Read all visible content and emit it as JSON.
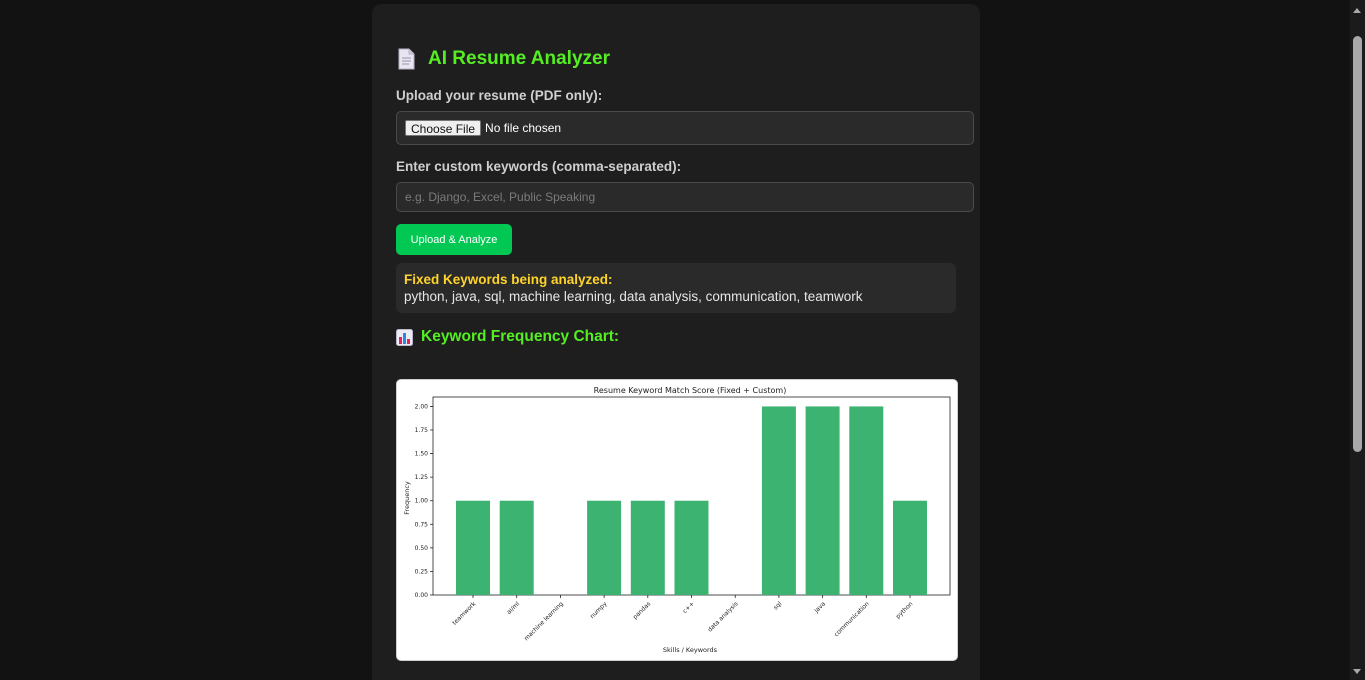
{
  "app": {
    "title": "AI Resume Analyzer",
    "title_icon": "document-icon",
    "accent_color": "#55ee22"
  },
  "upload": {
    "label": "Upload your resume (PDF only):",
    "button_label": "Choose File",
    "status": "No file chosen"
  },
  "keywords": {
    "label": "Enter custom keywords (comma-separated):",
    "value": "",
    "placeholder": "e.g. Django, Excel, Public Speaking"
  },
  "actions": {
    "analyze_label": "Upload & Analyze",
    "analyze_color": "#00c853"
  },
  "fixed_keywords": {
    "title": "Fixed Keywords being analyzed:",
    "list": "python, java, sql, machine learning, data analysis, communication, teamwork",
    "title_color": "#ffd42a"
  },
  "chart_section": {
    "heading": "Keyword Frequency Chart:",
    "heading_icon": "bar-chart-icon"
  },
  "chart_data": {
    "type": "bar",
    "title": "Resume Keyword Match Score (Fixed + Custom)",
    "xlabel": "Skills / Keywords",
    "ylabel": "Frequency",
    "categories": [
      "teamwork",
      "ai/ml",
      "machine learning",
      "numpy",
      "pandas",
      "c++",
      "data analysis",
      "sql",
      "java",
      "communication",
      "python"
    ],
    "values": [
      1,
      1,
      0,
      1,
      1,
      1,
      0,
      2,
      2,
      2,
      1
    ],
    "ylim": [
      0,
      2.1
    ],
    "yticks": [
      "0.00",
      "0.25",
      "0.50",
      "0.75",
      "1.00",
      "1.25",
      "1.50",
      "1.75",
      "2.00"
    ],
    "bar_color": "#3cb371",
    "grid": false
  }
}
